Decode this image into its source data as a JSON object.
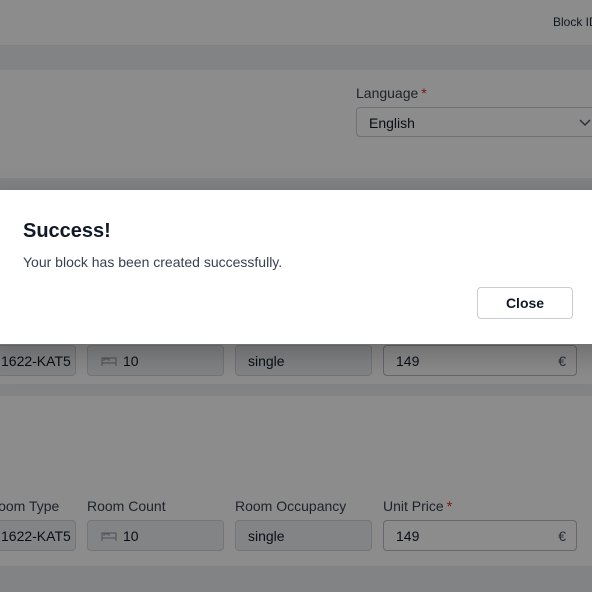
{
  "header": {
    "block_id_label": "Block ID"
  },
  "language": {
    "label": "Language",
    "required_mark": "*",
    "value": "English"
  },
  "rows": [
    {
      "room_type": "1622-KAT5",
      "room_count": "10",
      "room_occupancy": "single",
      "unit_price": "149",
      "currency": "€"
    },
    {
      "labels": {
        "room_type": "Room Type",
        "room_count": "Room Count",
        "room_occupancy": "Room Occupancy",
        "unit_price": "Unit Price",
        "required_mark": "*"
      },
      "room_type": "1622-KAT5",
      "room_count": "10",
      "room_occupancy": "single",
      "unit_price": "149",
      "currency": "€"
    }
  ],
  "dialog": {
    "title": "Success!",
    "message": "Your block has been created successfully.",
    "close_label": "Close"
  },
  "icons": {
    "bed": "bed-icon",
    "chevron": "chevron-down-icon"
  }
}
